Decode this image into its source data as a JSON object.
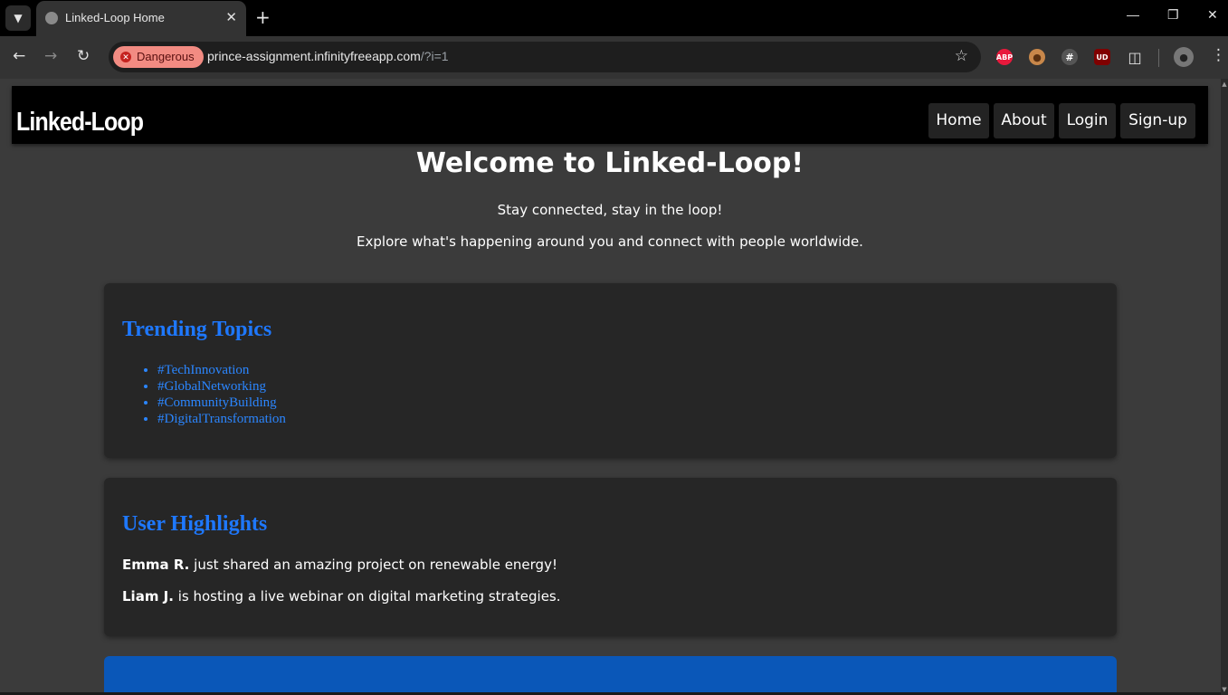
{
  "browser": {
    "tab_title": "Linked-Loop Home",
    "security_label": "Dangerous",
    "url_host": "prince-assignment.infinityfreeapp.com",
    "url_query": "/?i=1",
    "extensions": [
      "adblock-icon",
      "cookie-icon",
      "hash-icon",
      "ublock-icon",
      "puzzle-icon"
    ],
    "ext_labels": {
      "adblock": "ABP",
      "ublock": "UD"
    }
  },
  "site": {
    "logo": "Linked-Loop",
    "nav": [
      {
        "label": "Home"
      },
      {
        "label": "About"
      },
      {
        "label": "Login"
      },
      {
        "label": "Sign-up"
      }
    ],
    "welcome_title": "Welcome to Linked-Loop!",
    "tagline": "Stay connected, stay in the loop!",
    "intro": "Explore what's happening around you and connect with people worldwide.",
    "trending": {
      "title": "Trending Topics",
      "topics": [
        "#TechInnovation",
        "#GlobalNetworking",
        "#CommunityBuilding",
        "#DigitalTransformation"
      ]
    },
    "highlights": {
      "title": "User Highlights",
      "items": [
        {
          "name": "Emma R.",
          "text": " just shared an amazing project on renewable energy!"
        },
        {
          "name": "Liam J.",
          "text": " is hosting a live webinar on digital marketing strategies."
        }
      ]
    }
  },
  "colors": {
    "accent": "#1e78ff",
    "page_bg": "#3b3b3b",
    "card_bg": "#262626",
    "danger": "#f28b82",
    "blue_card": "#0a57b8"
  }
}
